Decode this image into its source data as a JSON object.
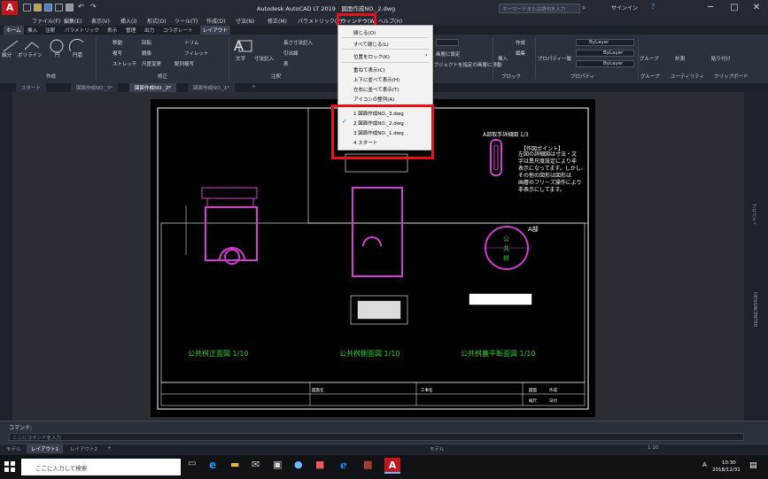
{
  "window": {
    "title": "Autodesk AutoCAD LT 2019　図面作成NO._2.dwg",
    "search_placeholder": "キーワードまたは語句を入力",
    "signin": "サインイン",
    "minimize": "─",
    "maximize": "□",
    "close": "✕"
  },
  "menubar": [
    "ファイル(F)",
    "編集(E)",
    "表示(V)",
    "挿入(I)",
    "形式(O)",
    "ツール(T)",
    "作成(D)",
    "寸法(N)",
    "修正(M)",
    "パラメトリック(P)",
    "ウィンドウ(W)",
    "ヘルプ(H)"
  ],
  "ribbon_tabs": [
    "ホーム",
    "挿入",
    "注釈",
    "パラメトリック",
    "表示",
    "管理",
    "出力",
    "コラボレート",
    "レイアウト"
  ],
  "ribbon": {
    "draw": {
      "line": "線分",
      "polyline": "ポリライン",
      "circle": "円",
      "arc": "円弧",
      "panel": "作成"
    },
    "modify": {
      "move": "移動",
      "rotate": "回転",
      "trim": "トリム",
      "copy": "複写",
      "mirror": "鏡像",
      "fillet": "フィレット",
      "stretch": "ストレッチ",
      "scale": "尺度変更",
      "array": "配列複写",
      "panel": "修正"
    },
    "annotation": {
      "text": "文字",
      "dimension": "寸法記入",
      "linear": "長さ寸法記入",
      "leader": "引出線",
      "table": "表",
      "panel": "注釈"
    },
    "block": {
      "insert": "挿入",
      "create": "作成",
      "edit": "編集",
      "panel": "ブロック"
    },
    "properties": {
      "bylayer1": "ByLayer",
      "bylayer2": "ByLayer",
      "bylayer3": "ByLayer",
      "panel": "プロパティ",
      "props": "プロパティ一致"
    },
    "groups": {
      "group": "グループ",
      "panel": "グループ"
    },
    "utilities": {
      "measure": "計測",
      "panel": "ユーティリティ"
    },
    "clipboard": {
      "paste": "貼り付け",
      "panel": "クリップボード"
    },
    "layer_text1": "画層に設定",
    "layer_text2": "オブジェクトを指定の画層に移動"
  },
  "doc_tabs": [
    "スタート",
    "図面作成NO._3*",
    "図面作成NO._2*",
    "図面作成NO._1*",
    "+"
  ],
  "window_menu": {
    "items": [
      "閉じる(O)",
      "すべて閉じる(L)",
      "位置をロック(K)",
      "重ねて表示(C)",
      "上下に並べて表示(H)",
      "左右に並べて表示(T)",
      "アイコンの整列(A)"
    ],
    "files": [
      "1 図面作成NO._3.dwg",
      "2 図面作成NO._2.dwg",
      "3 図面作成NO._1.dwg",
      "4 スタート"
    ],
    "checked_index": 1
  },
  "drawing": {
    "view1": "公共桝正面図 1/10",
    "view2": "公共桝側面図 1/10",
    "view3": "公共桝蓋平断面図 1/10",
    "detail_title": "A部取手詳細図 1/3",
    "note_title": "【作図ポイント】",
    "note_lines": [
      "左図の詳細図は寸法・文",
      "字は異尺度設定により非",
      "表示になってます。しかし、",
      "その他の図形は図形は",
      "画層のフリーズ操作により",
      "非表示にしてます。"
    ],
    "a_label": "A部",
    "cover_text": [
      "公",
      "共",
      "桝"
    ],
    "tb": [
      "図面名",
      "工事名",
      "図面",
      "作成",
      "縮尺",
      "日付"
    ]
  },
  "command": {
    "label": "コマンド:",
    "placeholder": "ここにコマンドを入力"
  },
  "layout_tabs": [
    "モデル",
    "レイアウト1",
    "レイアウト2",
    "+"
  ],
  "status": {
    "space": "モデル",
    "scale": "1:10"
  },
  "taskbar": {
    "search": "ここに入力して検索",
    "time": "10:30",
    "date": "2018/12/31",
    "ime": "A"
  },
  "side": {
    "props_tab": "プロパティ",
    "design_tab": "DESIGNCENTER",
    "layer_panel": "画層プロパティ管理"
  },
  "colors": {
    "accent_red": "#e5121c",
    "magenta": "#d63ad6",
    "green_text": "#33cc33",
    "bg_canvas": "#2a2d33"
  }
}
